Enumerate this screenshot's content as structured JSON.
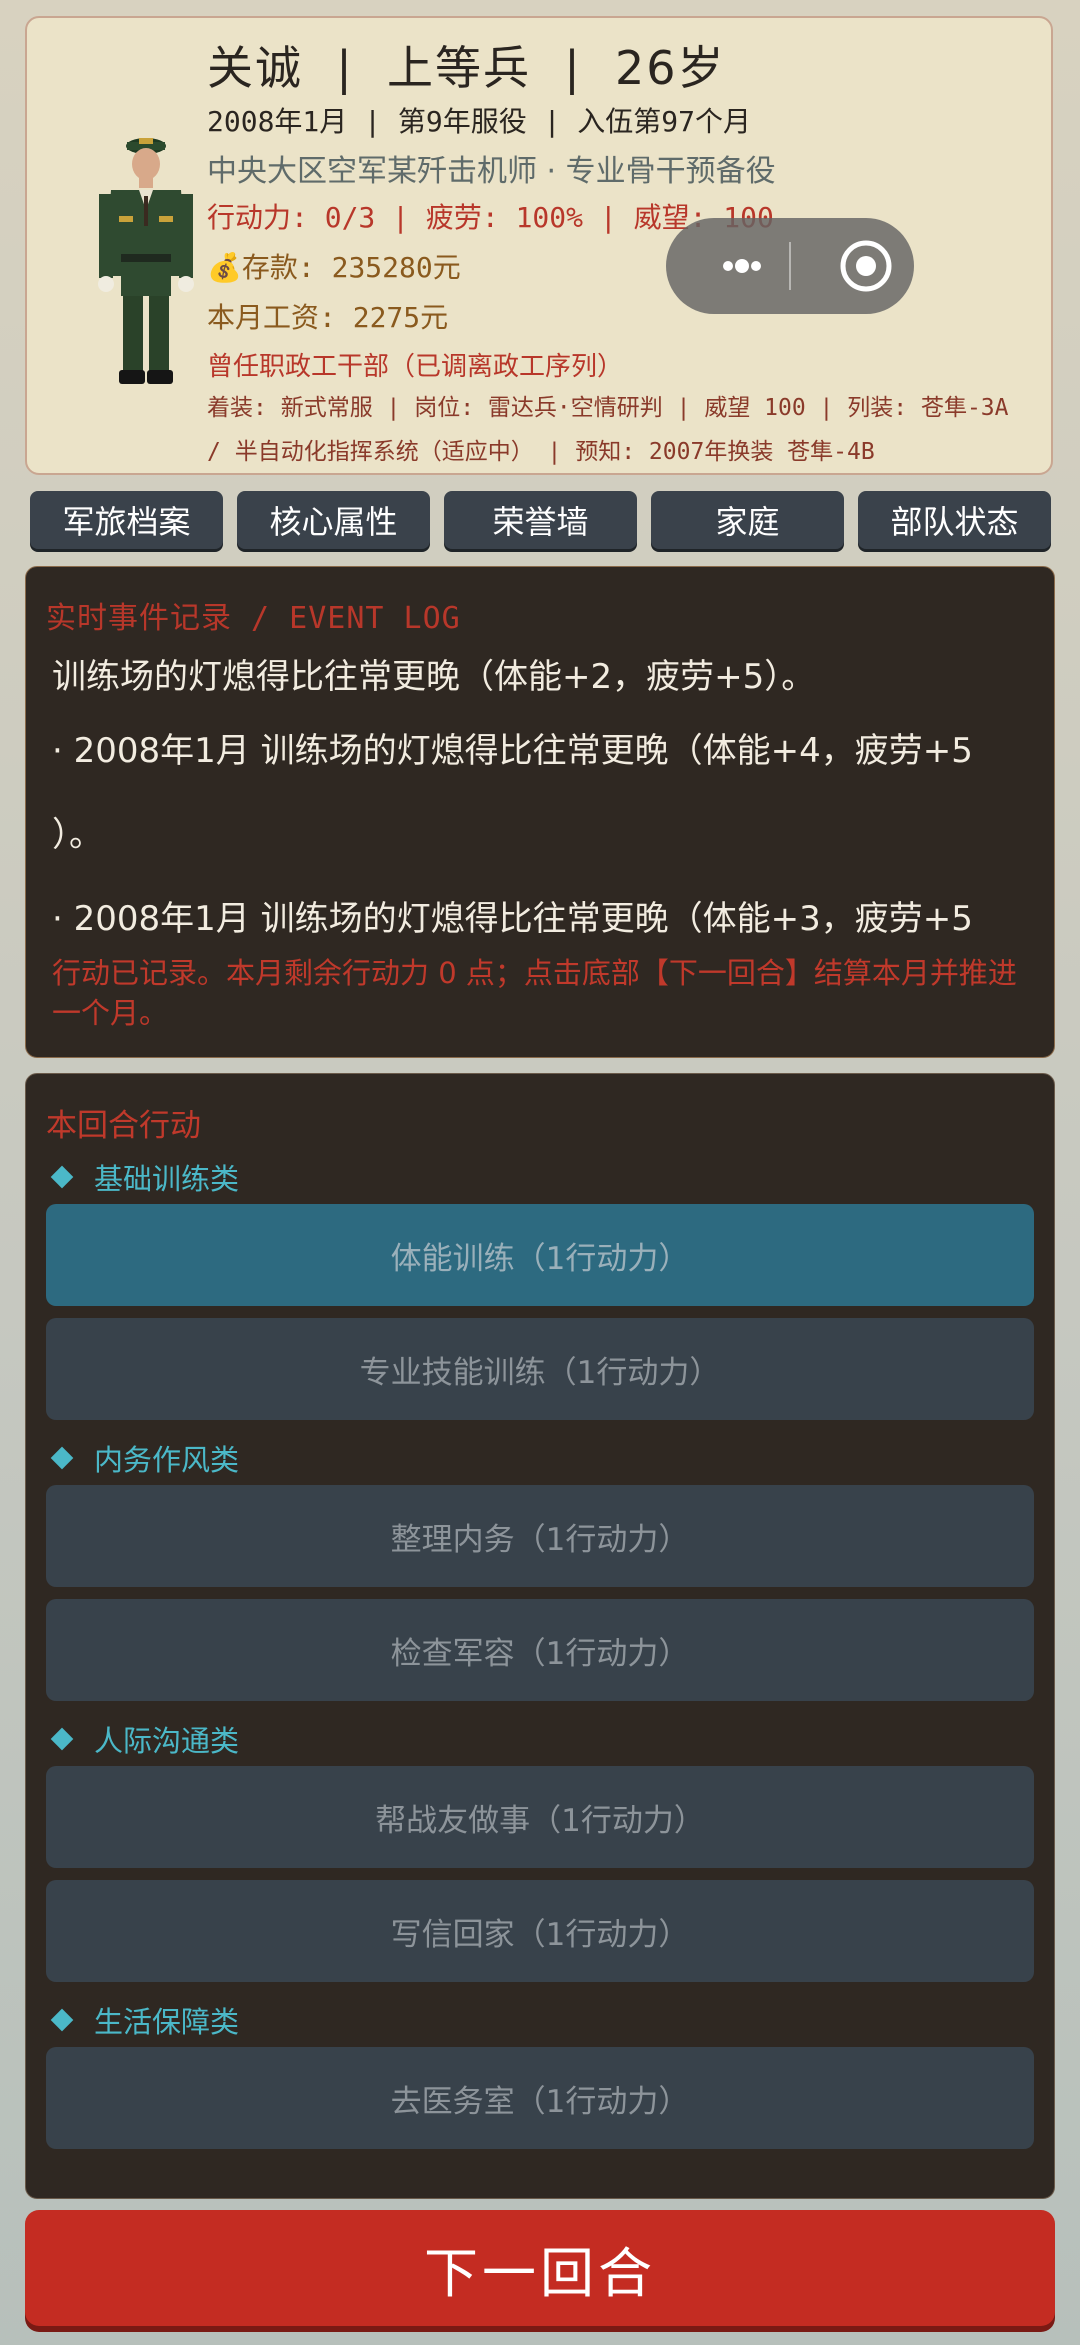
{
  "profile": {
    "name_line": "关诚  |  上等兵  |  26岁",
    "service_line": "2008年1月 | 第9年服役 | 入伍第97个月",
    "unit_line": "中央大区空军某歼击机师 · 专业骨干预备役",
    "stats_line": "行动力: 0/3 | 疲劳: 100% | 威望: 100",
    "savings_icon": "money-bag-icon",
    "savings_line": "存款: 235280元",
    "salary_line": "本月工资: 2275元",
    "former_line": "曾任职政工干部（已调离政工序列）",
    "equip_line1": "着装: 新式常服 | 岗位: 雷达兵·空情研判 | 威望 100 | 列装: 苍隼-3A",
    "equip_line2": "/ 半自动化指挥系统（适应中） | 预知: 2007年换装 苍隼-4B"
  },
  "capsule": {
    "more_icon": "more-dots-icon",
    "close_icon": "target-close-icon"
  },
  "tabs": [
    "军旅档案",
    "核心属性",
    "荣誉墙",
    "家庭",
    "部队状态"
  ],
  "event_log": {
    "title": "实时事件记录 / EVENT LOG",
    "lines": [
      "训练场的灯熄得比往常更晚（体能+2，疲劳+5）。",
      "·  2008年1月 训练场的灯熄得比往常更晚（体能+4，疲劳+5",
      "）。",
      "·  2008年1月 训练场的灯熄得比往常更晚（体能+3，疲劳+5"
    ],
    "note": "行动已记录。本月剩余行动力 0 点；点击底部【下一回合】结算本月并推进一个月。"
  },
  "actions": {
    "title": "本回合行动",
    "categories": [
      {
        "label": "基础训练类",
        "buttons": [
          "体能训练（1行动力）",
          "专业技能训练（1行动力）"
        ]
      },
      {
        "label": "内务作风类",
        "buttons": [
          "整理内务（1行动力）",
          "检查军容（1行动力）"
        ]
      },
      {
        "label": "人际沟通类",
        "buttons": [
          "帮战友做事（1行动力）",
          "写信回家（1行动力）"
        ]
      },
      {
        "label": "生活保障类",
        "buttons": [
          "去医务室（1行动力）"
        ]
      }
    ]
  },
  "next_button": "下一回合",
  "colors": {
    "accent_red": "#c42c22",
    "cyan": "#4bb8c8",
    "panel_dark": "#2f2822"
  }
}
